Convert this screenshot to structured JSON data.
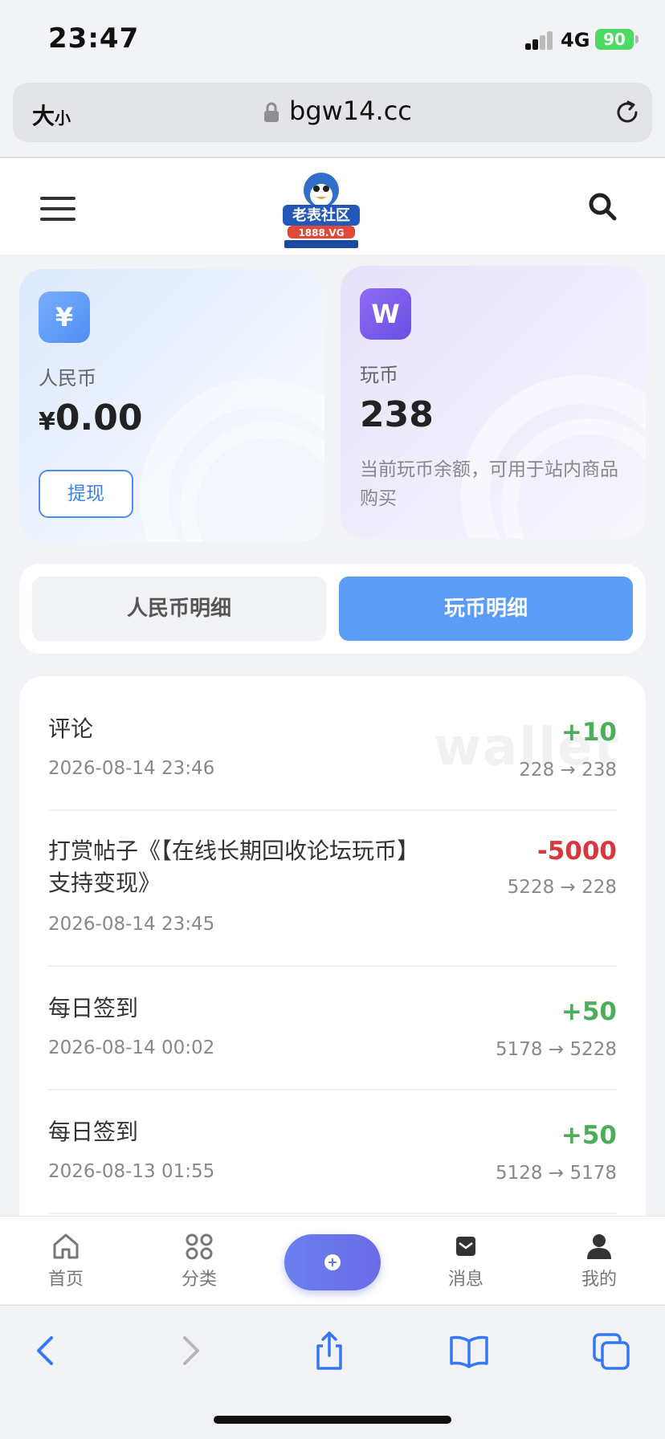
{
  "status_bar": {
    "time": "23:47",
    "network": "4G",
    "battery": "90"
  },
  "browser": {
    "text_size_label": "大",
    "text_size_small": "小",
    "url": "bgw14.cc"
  },
  "header": {
    "logo_alt": "老表社区 1888.VG"
  },
  "wallet": {
    "rmb": {
      "icon_glyph": "¥",
      "label": "人民币",
      "currency_symbol": "¥",
      "amount": "0.00",
      "withdraw_label": "提现"
    },
    "coin": {
      "icon_glyph": "W",
      "label": "玩币",
      "amount": "238",
      "description": "当前玩币余额，可用于站内商品购买"
    }
  },
  "tabs": [
    {
      "label": "人民币明细",
      "active": false
    },
    {
      "label": "玩币明细",
      "active": true
    }
  ],
  "transactions": {
    "watermark": "wallet",
    "items": [
      {
        "title": "评论",
        "date": "2026-08-14 23:46",
        "delta": "+10",
        "balance": "228 → 238"
      },
      {
        "title": "打赏帖子《【在线长期回收论坛玩币】支持变现》",
        "title_line1": "打赏帖子《【在线长期回收论坛玩币】",
        "title_line2": "支持变现》",
        "date": "2026-08-14 23:45",
        "delta": "-5000",
        "balance": "5228 → 228"
      },
      {
        "title": "每日签到",
        "date": "2026-08-14 00:02",
        "delta": "+50",
        "balance": "5178 → 5228"
      },
      {
        "title": "每日签到",
        "date": "2026-08-13 01:55",
        "delta": "+50",
        "balance": "5128 → 5178"
      }
    ]
  },
  "bottom_nav": [
    {
      "label": "首页",
      "icon": "home-icon"
    },
    {
      "label": "分类",
      "icon": "grid-icon"
    },
    {
      "label": "",
      "icon": "plus-icon"
    },
    {
      "label": "消息",
      "icon": "message-icon"
    },
    {
      "label": "我的",
      "icon": "user-icon"
    }
  ],
  "colors": {
    "accent": "#5b9cf6",
    "positive": "#4cae5a",
    "negative": "#d9363e",
    "fab": "#6a75ec"
  }
}
